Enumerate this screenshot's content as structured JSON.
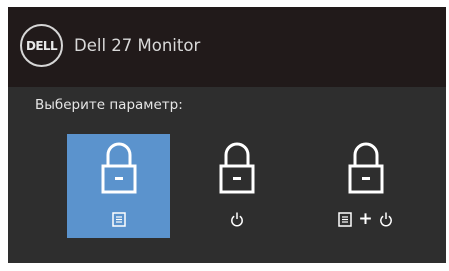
{
  "header": {
    "logo_text": "DELL",
    "title": "Dell 27 Monitor"
  },
  "main": {
    "prompt": "Выберите параметр:",
    "options": [
      {
        "id": "menu-lock",
        "icons": [
          "lock-icon",
          "menu-icon"
        ],
        "selected": true
      },
      {
        "id": "power-lock",
        "icons": [
          "lock-icon",
          "power-icon"
        ],
        "selected": false
      },
      {
        "id": "menu-power-lock",
        "icons": [
          "lock-icon",
          "menu-icon",
          "plus",
          "power-icon"
        ],
        "combo_symbol": "+",
        "selected": false
      }
    ]
  },
  "colors": {
    "header_bg": "#211a1a",
    "panel_bg": "#2e2e2e",
    "selected_bg": "#5b93cd",
    "icon": "#ffffff"
  }
}
